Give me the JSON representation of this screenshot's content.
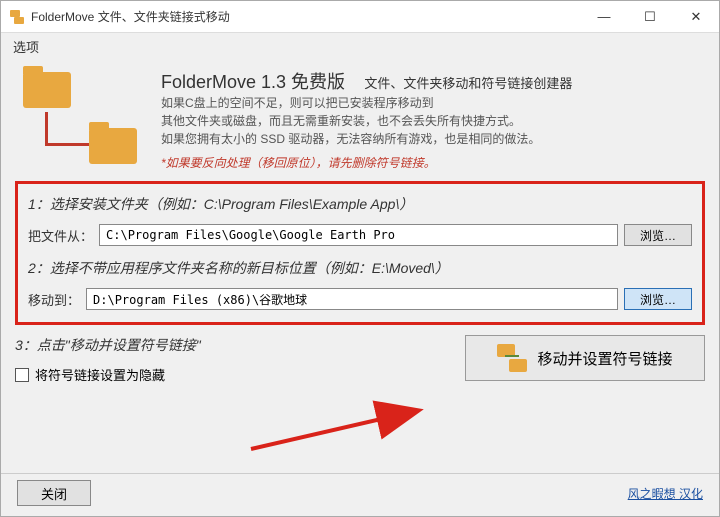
{
  "window": {
    "title": "FolderMove 文件、文件夹链接式移动"
  },
  "menu": {
    "options": "选项"
  },
  "header": {
    "app_title": "FolderMove 1.3 免费版",
    "subtitle": "文件、文件夹移动和符号链接创建器",
    "desc1": "如果C盘上的空间不足，则可以把已安装程序移动到",
    "desc2": "其他文件夹或磁盘，而且无需重新安装，也不会丢失所有快捷方式。",
    "desc3": "如果您拥有太小的 SSD 驱动器，无法容纳所有游戏，也是相同的做法。",
    "warning": "*如果要反向处理（移回原位），请先删除符号链接。"
  },
  "step1": {
    "label": "1：选择安装文件夹（例如：C:\\Program Files\\Example App\\）",
    "field_label": "把文件从：",
    "value": "C:\\Program Files\\Google\\Google Earth Pro",
    "browse": "浏览…"
  },
  "step2": {
    "label": "2：选择不带应用程序文件夹名称的新目标位置（例如：E:\\Moved\\）",
    "field_label": "移动到：",
    "value": "D:\\Program Files (x86)\\谷歌地球",
    "browse": "浏览…"
  },
  "step3": {
    "label": "3：点击\"移动并设置符号链接\"",
    "checkbox_label": "将符号链接设置为隐藏",
    "move_button": "移动并设置符号链接"
  },
  "footer": {
    "close": "关闭",
    "credit": "风之暇想 汉化"
  }
}
